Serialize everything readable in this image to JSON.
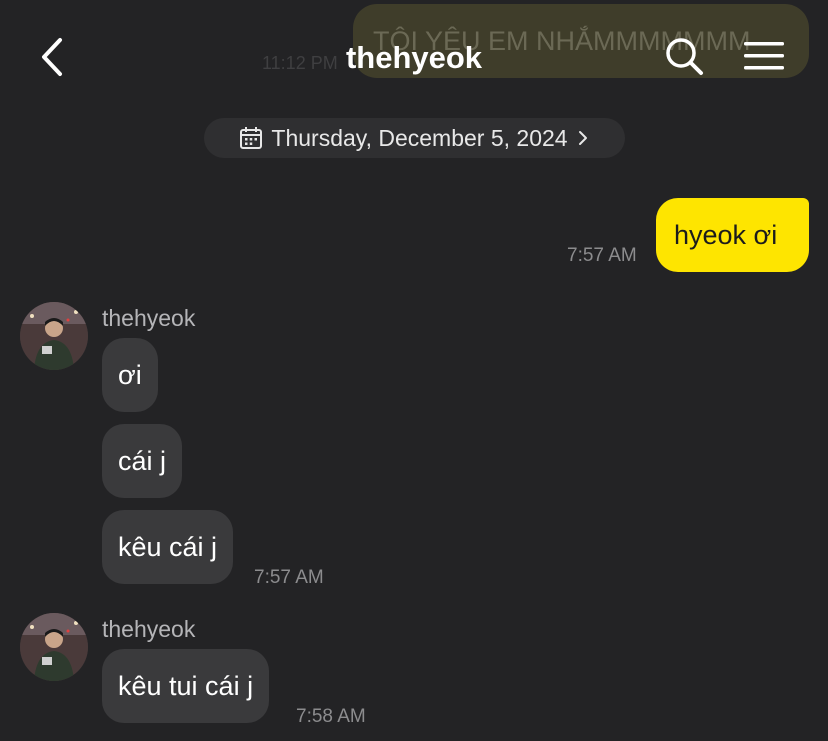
{
  "previous_message": {
    "text": "TÔI YÊU EM NHẮMMMMMMM",
    "time": "11:12 PM"
  },
  "header": {
    "title": "thehyeok",
    "back_icon": "chevron-left-icon",
    "search_icon": "search-icon",
    "menu_icon": "hamburger-menu-icon"
  },
  "date_divider": {
    "label": "Thursday, December 5, 2024",
    "icon": "calendar-icon"
  },
  "messages": [
    {
      "direction": "outgoing",
      "text": "hyeok ơi",
      "time": "7:57 AM"
    },
    {
      "direction": "incoming",
      "sender": "thehyeok",
      "bubbles": [
        "ơi",
        "cái j",
        "kêu cái j"
      ],
      "time": "7:57 AM"
    },
    {
      "direction": "incoming",
      "sender": "thehyeok",
      "bubbles": [
        "kêu tui cái j"
      ],
      "time": "7:58 AM"
    }
  ],
  "colors": {
    "background": "#232325",
    "outgoing_bubble": "#fee500",
    "incoming_bubble": "#3a3a3c"
  }
}
